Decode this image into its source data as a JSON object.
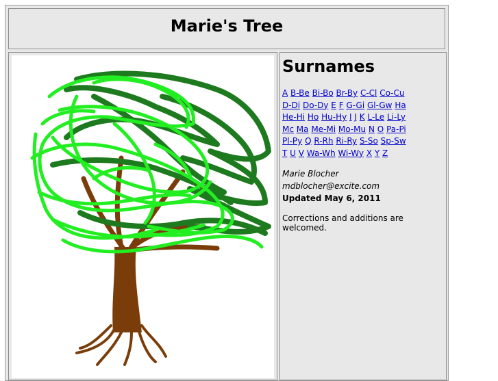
{
  "header": {
    "title": "Marie's Tree"
  },
  "sidebar": {
    "heading": "Surnames",
    "index_rows": [
      [
        "A",
        "B-Be",
        "Bi-Bo",
        "Br-By",
        "C-Cl",
        "Co-Cu"
      ],
      [
        "D-Di",
        "Do-Dy",
        "E",
        "F",
        "G-Gi",
        "Gl-Gw",
        "Ha"
      ],
      [
        "He-Hi",
        "Ho",
        "Hu-Hy",
        "I",
        "J",
        "K",
        "L-Le",
        "Li-Ly"
      ],
      [
        "Mc",
        "Ma",
        "Me-Mi",
        "Mo-Mu",
        "N",
        "O",
        "Pa-Pi"
      ],
      [
        "Pl-Py",
        "Q",
        "R-Rh",
        "Ri-Ry",
        "S-So",
        "Sp-Sw"
      ],
      [
        "T",
        "U",
        "V",
        "Wa-Wh",
        "Wi-Wy",
        "X",
        "Y",
        "Z"
      ]
    ],
    "author": "Marie Blocher",
    "email": "mdblocher@excite.com",
    "updated": "Updated May 6, 2011",
    "note": "Corrections and additions are welcomed."
  },
  "colors": {
    "link": "#0000cc",
    "trunk": "#7a3d0a",
    "leaf_dark": "#1e7a1e",
    "leaf_light": "#22ee22",
    "panel": "#e8e8e8"
  },
  "image": {
    "icon": "tree-drawing"
  }
}
